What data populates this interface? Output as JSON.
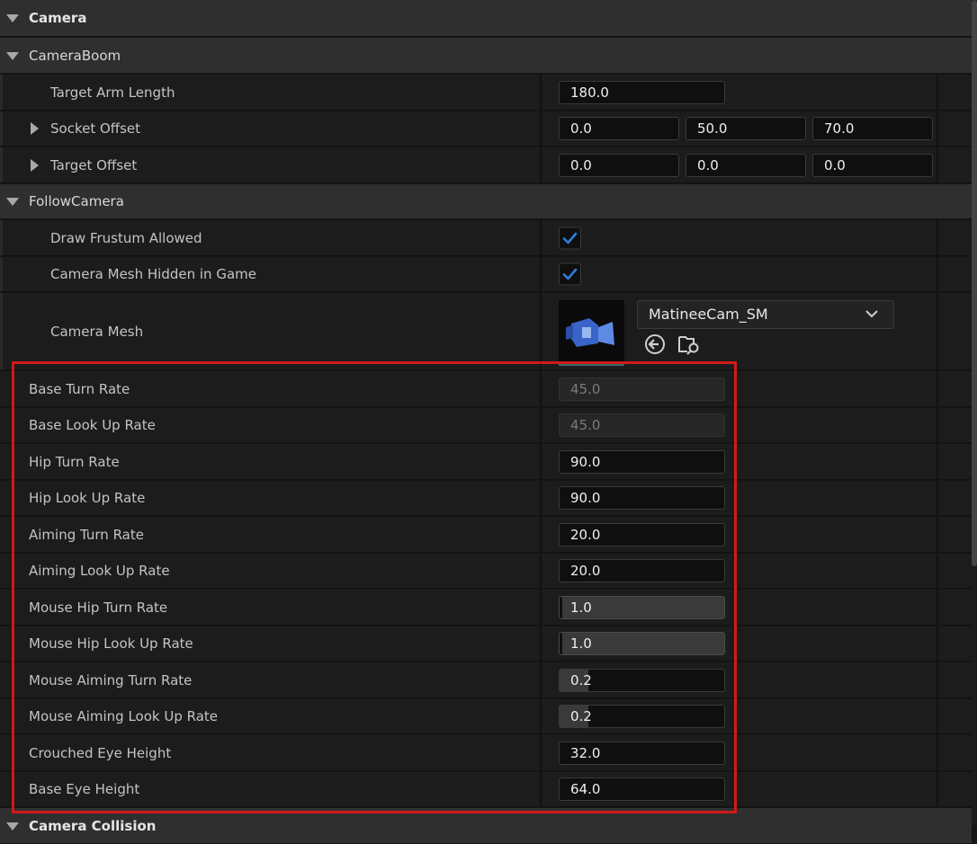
{
  "sections": {
    "camera": "Camera",
    "camera_boom": "CameraBoom",
    "follow_camera": "FollowCamera",
    "camera_collision": "Camera Collision"
  },
  "camera_boom": {
    "target_arm_length": {
      "label": "Target Arm Length",
      "value": "180.0"
    },
    "socket_offset": {
      "label": "Socket Offset",
      "x": "0.0",
      "y": "50.0",
      "z": "70.0"
    },
    "target_offset": {
      "label": "Target Offset",
      "x": "0.0",
      "y": "0.0",
      "z": "0.0"
    }
  },
  "follow_camera": {
    "draw_frustum": {
      "label": "Draw Frustum Allowed",
      "checked": true
    },
    "mesh_hidden": {
      "label": "Camera Mesh Hidden in Game",
      "checked": true
    },
    "camera_mesh": {
      "label": "Camera Mesh",
      "asset": "MatineeCam_SM"
    }
  },
  "properties": [
    {
      "label": "Base Turn Rate",
      "value": "45.0",
      "style": "disabled"
    },
    {
      "label": "Base Look Up Rate",
      "value": "45.0",
      "style": "disabled"
    },
    {
      "label": "Hip Turn Rate",
      "value": "90.0",
      "style": "normal"
    },
    {
      "label": "Hip Look Up Rate",
      "value": "90.0",
      "style": "normal"
    },
    {
      "label": "Aiming Turn Rate",
      "value": "20.0",
      "style": "normal"
    },
    {
      "label": "Aiming Look Up Rate",
      "value": "20.0",
      "style": "normal"
    },
    {
      "label": "Mouse Hip Turn Rate",
      "value": "1.0",
      "style": "slider"
    },
    {
      "label": "Mouse Hip Look Up Rate",
      "value": "1.0",
      "style": "slider"
    },
    {
      "label": "Mouse Aiming Turn Rate",
      "value": "0.2",
      "style": "partial"
    },
    {
      "label": "Mouse Aiming Look Up Rate",
      "value": "0.2",
      "style": "partial"
    },
    {
      "label": "Crouched Eye Height",
      "value": "32.0",
      "style": "normal"
    },
    {
      "label": "Base Eye Height",
      "value": "64.0",
      "style": "normal"
    }
  ],
  "colors": {
    "accent_check": "#2f7fd6",
    "highlight": "#d11a1a"
  }
}
